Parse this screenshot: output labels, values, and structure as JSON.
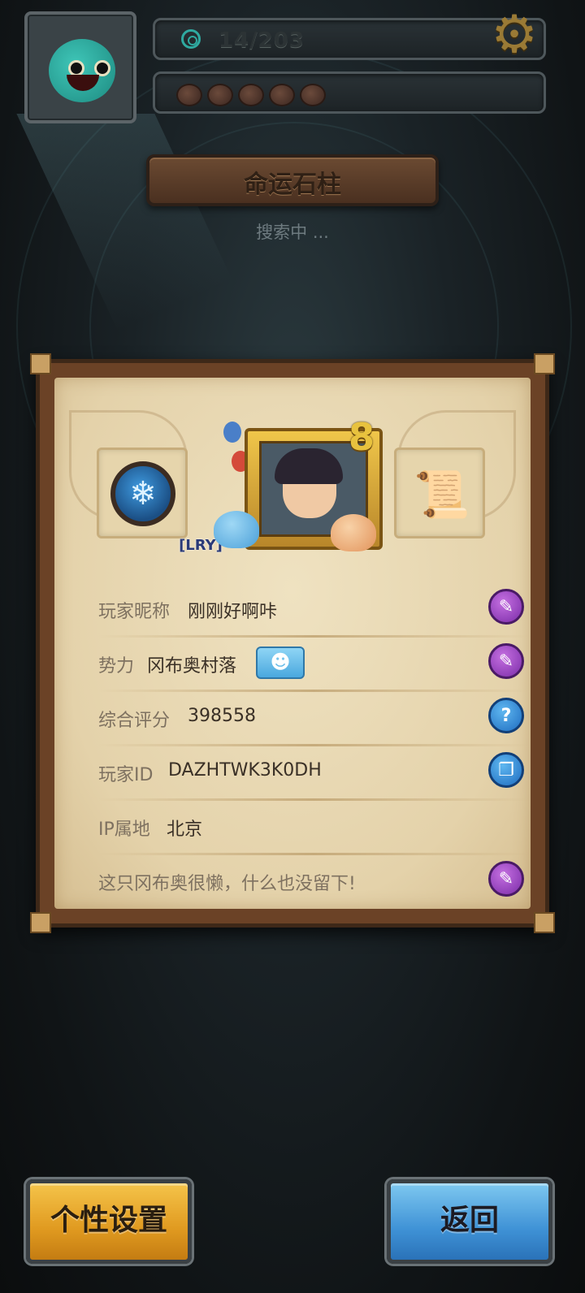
{
  "hud": {
    "counter": "14/203",
    "resource_slots": 5
  },
  "header": {
    "title": "命运石柱",
    "status": "搜索中 ..."
  },
  "profile": {
    "guild_tag": "[LRY]",
    "level": "8",
    "rows": {
      "nickname_label": "玩家昵称",
      "nickname_value": "刚刚好啊咔",
      "faction_label": "势力",
      "faction_value": "冈布奥村落",
      "score_label": "综合评分",
      "score_value": "398558",
      "id_label": "玩家ID",
      "id_value": "DAZHTWK3K0DH",
      "ip_label": "IP属地",
      "ip_value": "北京",
      "bio": "这只冈布奥很懒，什么也没留下!"
    }
  },
  "buttons": {
    "settings": "个性设置",
    "back": "返回"
  },
  "icons": {
    "edit": "pencil-icon",
    "help": "question-icon",
    "copy": "copy-icon",
    "settings": "gear-icon"
  },
  "colors": {
    "purple_button": "#7b2ca8",
    "blue_button": "#1e6cc0",
    "orange_button": "#e09a20",
    "parchment": "#e4d2aa"
  }
}
